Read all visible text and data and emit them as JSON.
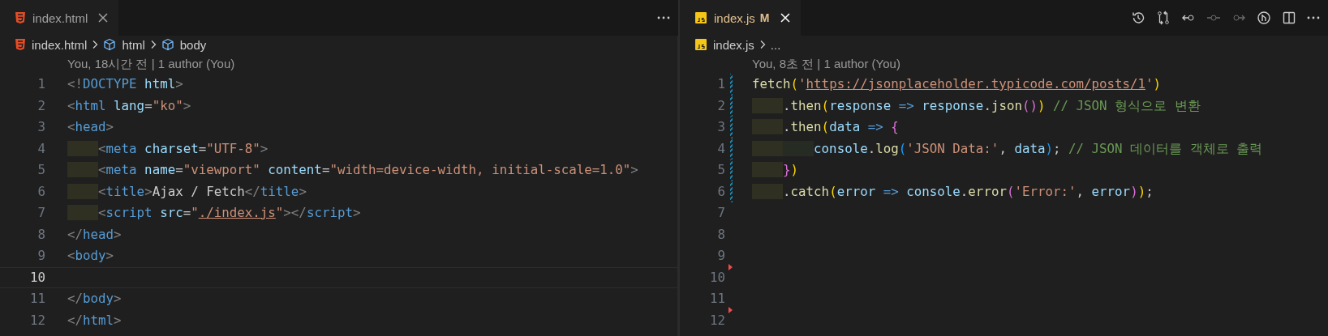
{
  "panes": [
    {
      "focused": false,
      "tab": {
        "label": "index.html",
        "kind": "html",
        "modified": false,
        "selected": true
      },
      "actions": [
        {
          "kind": "more",
          "disabled": false
        }
      ],
      "breadcrumbs": [
        {
          "label": "index.html",
          "kind": "html"
        },
        {
          "label": "html",
          "kind": "element"
        },
        {
          "label": "body",
          "kind": "element"
        }
      ],
      "codelens": "You, 18시간 전 | 1 author (You)",
      "lines": [
        {
          "number": "1",
          "current": false,
          "kind": "plain",
          "tokens": [
            {
              "text": "<!",
              "kind": "p"
            },
            {
              "text": "DOCTYPE",
              "kind": "tg"
            },
            {
              "text": " html",
              "kind": "at"
            },
            {
              "text": ">",
              "kind": "p"
            }
          ]
        },
        {
          "number": "2",
          "current": false,
          "kind": "plain",
          "tokens": [
            {
              "text": "<",
              "kind": "p"
            },
            {
              "text": "html",
              "kind": "tg"
            },
            {
              "text": " lang",
              "kind": "at"
            },
            {
              "text": "=",
              "kind": "x"
            },
            {
              "text": "\"ko\"",
              "kind": "s"
            },
            {
              "text": ">",
              "kind": "p"
            }
          ]
        },
        {
          "number": "3",
          "current": false,
          "kind": "plain",
          "tokens": [
            {
              "text": "<",
              "kind": "p"
            },
            {
              "text": "head",
              "kind": "tg"
            },
            {
              "text": ">",
              "kind": "p"
            }
          ]
        },
        {
          "number": "4",
          "current": false,
          "kind": "plain",
          "tokens": [
            {
              "text": "    <",
              "kind": "p"
            },
            {
              "text": "meta",
              "kind": "tg"
            },
            {
              "text": " charset",
              "kind": "at"
            },
            {
              "text": "=",
              "kind": "x"
            },
            {
              "text": "\"UTF-8\"",
              "kind": "s"
            },
            {
              "text": ">",
              "kind": "p"
            }
          ]
        },
        {
          "number": "5",
          "current": false,
          "kind": "plain",
          "tokens": [
            {
              "text": "    <",
              "kind": "p"
            },
            {
              "text": "meta",
              "kind": "tg"
            },
            {
              "text": " name",
              "kind": "at"
            },
            {
              "text": "=",
              "kind": "x"
            },
            {
              "text": "\"viewport\"",
              "kind": "s"
            },
            {
              "text": " content",
              "kind": "at"
            },
            {
              "text": "=",
              "kind": "x"
            },
            {
              "text": "\"width=device-width, initial-scale=1.0\"",
              "kind": "s"
            },
            {
              "text": ">",
              "kind": "p"
            }
          ]
        },
        {
          "number": "6",
          "current": false,
          "kind": "plain",
          "tokens": [
            {
              "text": "    <",
              "kind": "p"
            },
            {
              "text": "title",
              "kind": "tg"
            },
            {
              "text": ">",
              "kind": "p"
            },
            {
              "text": "Ajax / Fetch",
              "kind": "x"
            },
            {
              "text": "</",
              "kind": "p"
            },
            {
              "text": "title",
              "kind": "tg"
            },
            {
              "text": ">",
              "kind": "p"
            }
          ]
        },
        {
          "number": "7",
          "current": false,
          "kind": "plain",
          "tokens": [
            {
              "text": "    <",
              "kind": "p"
            },
            {
              "text": "script",
              "kind": "tg"
            },
            {
              "text": " src",
              "kind": "at"
            },
            {
              "text": "=",
              "kind": "x"
            },
            {
              "text": "\"",
              "kind": "s"
            },
            {
              "text": "./index.js",
              "kind": "u"
            },
            {
              "text": "\"",
              "kind": "s"
            },
            {
              "text": "></",
              "kind": "p"
            },
            {
              "text": "script",
              "kind": "tg"
            },
            {
              "text": ">",
              "kind": "p"
            }
          ]
        },
        {
          "number": "8",
          "current": false,
          "kind": "plain",
          "tokens": [
            {
              "text": "</",
              "kind": "p"
            },
            {
              "text": "head",
              "kind": "tg"
            },
            {
              "text": ">",
              "kind": "p"
            }
          ]
        },
        {
          "number": "9",
          "current": false,
          "kind": "plain",
          "tokens": [
            {
              "text": "<",
              "kind": "p"
            },
            {
              "text": "body",
              "kind": "tg"
            },
            {
              "text": ">",
              "kind": "p"
            }
          ]
        },
        {
          "number": "10",
          "current": true,
          "kind": "plain"
        },
        {
          "number": "11",
          "current": false,
          "kind": "plain",
          "tokens": [
            {
              "text": "</",
              "kind": "p"
            },
            {
              "text": "body",
              "kind": "tg"
            },
            {
              "text": ">",
              "kind": "p"
            }
          ]
        },
        {
          "number": "12",
          "current": false,
          "kind": "plain",
          "tokens": [
            {
              "text": "</",
              "kind": "p"
            },
            {
              "text": "html",
              "kind": "tg"
            },
            {
              "text": ">",
              "kind": "p"
            }
          ]
        }
      ]
    },
    {
      "focused": true,
      "tab": {
        "label": "index.js",
        "kind": "js",
        "modified": true,
        "badge": "M",
        "selected": true
      },
      "actions": [
        {
          "kind": "history",
          "disabled": false
        },
        {
          "kind": "compare",
          "disabled": false
        },
        {
          "kind": "previous",
          "disabled": false
        },
        {
          "kind": "commit",
          "disabled": true
        },
        {
          "kind": "next",
          "disabled": true
        },
        {
          "kind": "blame",
          "disabled": false
        },
        {
          "kind": "split",
          "disabled": false
        },
        {
          "kind": "more",
          "disabled": false
        }
      ],
      "breadcrumbs": [
        {
          "label": "index.js",
          "kind": "js"
        },
        {
          "label": "...",
          "kind": "symbol"
        }
      ],
      "codelens": "You, 8초 전 | 1 author (You)",
      "lines": [
        {
          "number": "1",
          "current": false,
          "kind": "modified",
          "tokens": [
            {
              "text": "fetch",
              "kind": "fn"
            },
            {
              "text": "(",
              "kind": "b1"
            },
            {
              "text": "'",
              "kind": "s"
            },
            {
              "text": "https://jsonplaceholder.typicode.com/posts/1",
              "kind": "u"
            },
            {
              "text": "'",
              "kind": "s"
            },
            {
              "text": ")",
              "kind": "b1"
            }
          ]
        },
        {
          "number": "2",
          "current": false,
          "kind": "modified",
          "tokens": [
            {
              "text": "    .",
              "kind": "x"
            },
            {
              "text": "then",
              "kind": "fn"
            },
            {
              "text": "(",
              "kind": "b1"
            },
            {
              "text": "response",
              "kind": "v"
            },
            {
              "text": " =>",
              "kind": "op"
            },
            {
              "text": " response",
              "kind": "v"
            },
            {
              "text": ".",
              "kind": "x"
            },
            {
              "text": "json",
              "kind": "fn"
            },
            {
              "text": "()",
              "kind": "b2"
            },
            {
              "text": ")",
              "kind": "b1"
            },
            {
              "text": " // JSON 형식으로 변환",
              "kind": "c"
            }
          ]
        },
        {
          "number": "3",
          "current": false,
          "kind": "modified",
          "tokens": [
            {
              "text": "    .",
              "kind": "x"
            },
            {
              "text": "then",
              "kind": "fn"
            },
            {
              "text": "(",
              "kind": "b1"
            },
            {
              "text": "data",
              "kind": "v"
            },
            {
              "text": " =>",
              "kind": "op"
            },
            {
              "text": " {",
              "kind": "b2"
            }
          ]
        },
        {
          "number": "4",
          "current": false,
          "kind": "modified",
          "tokens": [
            {
              "text": "        console",
              "kind": "v"
            },
            {
              "text": ".",
              "kind": "x"
            },
            {
              "text": "log",
              "kind": "fn"
            },
            {
              "text": "(",
              "kind": "b3"
            },
            {
              "text": "'JSON Data:'",
              "kind": "s"
            },
            {
              "text": ",",
              "kind": "x"
            },
            {
              "text": " data",
              "kind": "v"
            },
            {
              "text": ")",
              "kind": "b3"
            },
            {
              "text": ";",
              "kind": "x"
            },
            {
              "text": " // JSON 데이터를 객체로 출력",
              "kind": "c"
            }
          ]
        },
        {
          "number": "5",
          "current": false,
          "kind": "modified",
          "tokens": [
            {
              "text": "    }",
              "kind": "b2"
            },
            {
              "text": ")",
              "kind": "b1"
            }
          ]
        },
        {
          "number": "6",
          "current": false,
          "kind": "modified",
          "tokens": [
            {
              "text": "    .",
              "kind": "x"
            },
            {
              "text": "catch",
              "kind": "fn"
            },
            {
              "text": "(",
              "kind": "b1"
            },
            {
              "text": "error",
              "kind": "v"
            },
            {
              "text": " =>",
              "kind": "op"
            },
            {
              "text": " console",
              "kind": "v"
            },
            {
              "text": ".",
              "kind": "x"
            },
            {
              "text": "error",
              "kind": "fn"
            },
            {
              "text": "(",
              "kind": "b2"
            },
            {
              "text": "'Error:'",
              "kind": "s"
            },
            {
              "text": ",",
              "kind": "x"
            },
            {
              "text": " error",
              "kind": "v"
            },
            {
              "text": ")",
              "kind": "b2"
            },
            {
              "text": ")",
              "kind": "b1"
            },
            {
              "text": ";",
              "kind": "x"
            }
          ]
        },
        {
          "number": "7",
          "current": false,
          "kind": "plain"
        },
        {
          "number": "8",
          "current": false,
          "kind": "plain"
        },
        {
          "number": "9",
          "current": false,
          "kind": "plain"
        },
        {
          "number": "10",
          "current": false,
          "kind": "deleted"
        },
        {
          "number": "11",
          "current": false,
          "kind": "plain"
        },
        {
          "number": "12",
          "current": false,
          "kind": "deleted"
        }
      ]
    }
  ]
}
